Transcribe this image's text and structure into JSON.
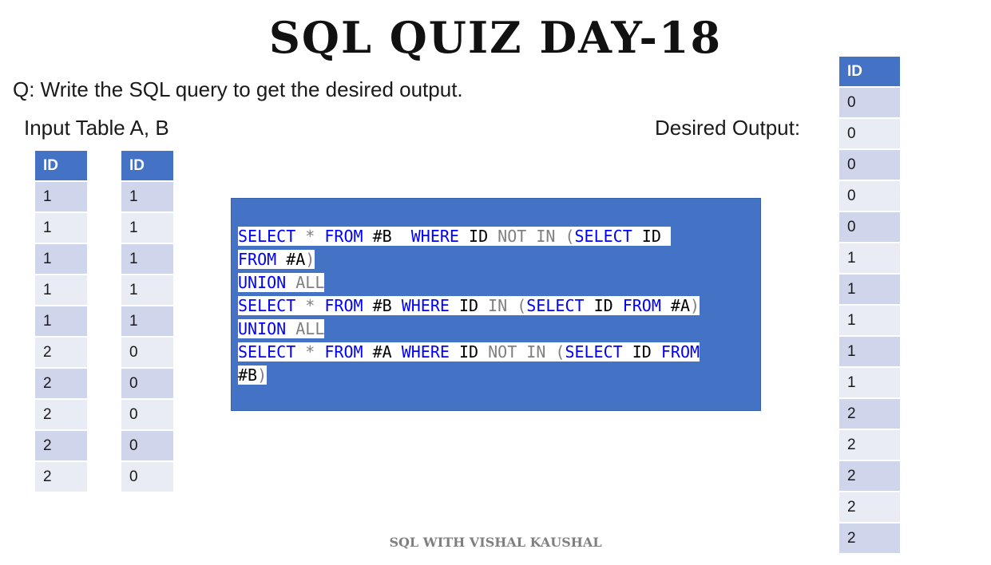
{
  "title": "SQL QUIZ DAY-18",
  "question": "Q: Write the SQL query to get the desired output.",
  "input_label": "Input Table A, B",
  "output_label": "Desired Output:",
  "table_a": {
    "header": "ID",
    "rows": [
      "1",
      "1",
      "1",
      "1",
      "1",
      "2",
      "2",
      "2",
      "2",
      "2"
    ]
  },
  "table_b": {
    "header": "ID",
    "rows": [
      "1",
      "1",
      "1",
      "1",
      "1",
      "0",
      "0",
      "0",
      "0",
      "0"
    ]
  },
  "table_output": {
    "header": "ID",
    "rows": [
      "0",
      "0",
      "0",
      "0",
      "0",
      "1",
      "1",
      "1",
      "1",
      "1",
      "2",
      "2",
      "2",
      "2",
      "2"
    ]
  },
  "code_lines": [
    [
      [
        "kw",
        "SELECT"
      ],
      [
        "op",
        " * "
      ],
      [
        "kw",
        "FROM"
      ],
      [
        "tx",
        " #B  "
      ],
      [
        "kw",
        "WHERE"
      ],
      [
        "tx",
        " ID "
      ],
      [
        "op",
        "NOT IN ("
      ],
      [
        "kw",
        "SELECT"
      ],
      [
        "tx",
        " ID "
      ]
    ],
    [
      [
        "kw",
        "FROM"
      ],
      [
        "tx",
        " #A"
      ],
      [
        "op",
        ")"
      ]
    ],
    [
      [
        "kw",
        "UNION"
      ],
      [
        "op",
        " ALL"
      ]
    ],
    [
      [
        "kw",
        "SELECT"
      ],
      [
        "op",
        " * "
      ],
      [
        "kw",
        "FROM"
      ],
      [
        "tx",
        " #B "
      ],
      [
        "kw",
        "WHERE"
      ],
      [
        "tx",
        " ID "
      ],
      [
        "op",
        "IN ("
      ],
      [
        "kw",
        "SELECT"
      ],
      [
        "tx",
        " ID "
      ],
      [
        "kw",
        "FROM"
      ],
      [
        "tx",
        " #A"
      ],
      [
        "op",
        ")"
      ]
    ],
    [
      [
        "kw",
        "UNION"
      ],
      [
        "op",
        " ALL"
      ]
    ],
    [
      [
        "kw",
        "SELECT"
      ],
      [
        "op",
        " * "
      ],
      [
        "kw",
        "FROM"
      ],
      [
        "tx",
        " #A "
      ],
      [
        "kw",
        "WHERE"
      ],
      [
        "tx",
        " ID "
      ],
      [
        "op",
        "NOT IN ("
      ],
      [
        "kw",
        "SELECT"
      ],
      [
        "tx",
        " ID "
      ],
      [
        "kw",
        "FROM"
      ]
    ],
    [
      [
        "tx",
        "#B"
      ],
      [
        "op",
        ")"
      ]
    ]
  ],
  "footer": "SQL WITH VISHAL KAUSHAL",
  "colors": {
    "header_blue": "#4472c4",
    "row_dark": "#cfd5ea",
    "row_light": "#e9ebf5",
    "keyword": "#0000ff",
    "operator": "#808080"
  }
}
